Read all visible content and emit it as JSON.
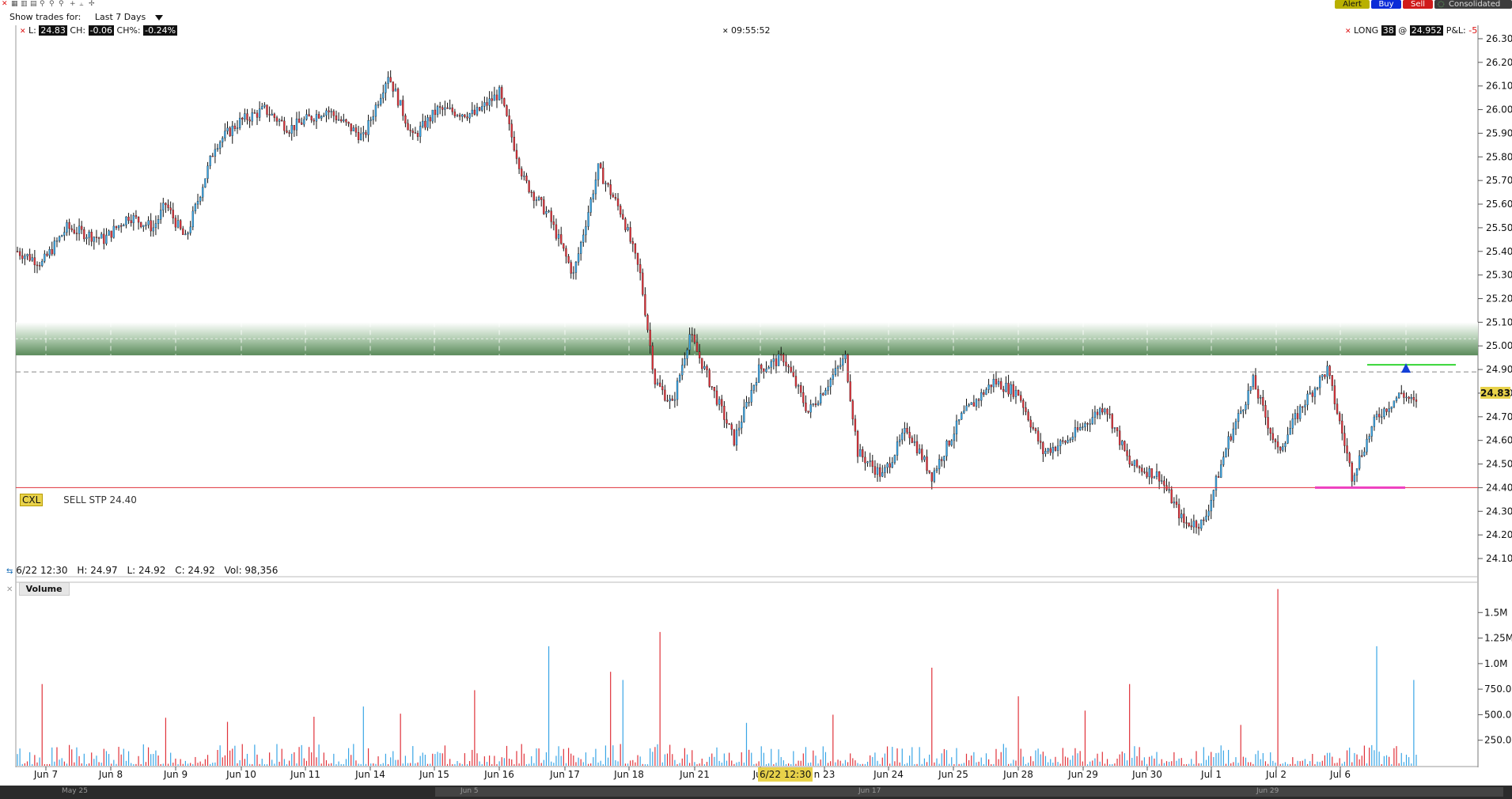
{
  "toolbar": {
    "alert_label": "Alert",
    "buy_label": "Buy",
    "sell_label": "Sell",
    "data_source_label": "Consolidated"
  },
  "filter": {
    "label": "Show trades for:",
    "value": "Last 7 Days"
  },
  "quote": {
    "last_label": "L:",
    "last_value": "24.83",
    "change_label": "CH:",
    "change_value": "-0.06",
    "change_pct_label": "CH%:",
    "change_pct_value": "-0.24%"
  },
  "clock": "09:55:52",
  "position": {
    "side": "LONG",
    "qty": "38",
    "at": "@",
    "price": "24.952",
    "pnl_label": "P&L:",
    "pnl_value": "-5"
  },
  "order": {
    "cancel_label": "CXL",
    "description": "SELL STP 24.40"
  },
  "bar_info": {
    "date": "6/22 12:30",
    "high": "H: 24.97",
    "low": "L: 24.92",
    "close": "C: 24.92",
    "volume": "Vol: 98,356"
  },
  "volume_panel": {
    "title": "Volume"
  },
  "time_axis": {
    "labels": [
      "Jun 7",
      "Jun 8",
      "Jun 9",
      "Jun 10",
      "Jun 11",
      "Jun 14",
      "Jun 15",
      "Jun 16",
      "Jun 17",
      "Jun 18",
      "Jun 21",
      "Jun",
      "n 23",
      "Jun 24",
      "Jun 25",
      "Jun 28",
      "Jun 29",
      "Jun 30",
      "Jul 1",
      "Jul 2",
      "Jul 6"
    ],
    "crosshair_label": "6/22 12:30"
  },
  "overview_labels": [
    "May 25",
    "Jun 5",
    "Jun 17",
    "Jun 29"
  ],
  "colors": {
    "up": "#3aa6e6",
    "down": "#e0323a",
    "support_zone": "#5a8a5a",
    "stop_line": "#e0323a",
    "entry_line": "#34d534",
    "stop_marker": "#ee3fbf"
  },
  "chart_data": {
    "type": "candlestick",
    "price_axis": {
      "ticks": [
        "26.30",
        "26.20",
        "26.10",
        "26.00",
        "25.90",
        "25.80",
        "25.70",
        "25.60",
        "25.50",
        "25.40",
        "25.30",
        "25.20",
        "25.10",
        "25.00",
        "24.90",
        "24.80",
        "24.70",
        "24.60",
        "24.50",
        "24.40",
        "24.30",
        "24.20",
        "24.10"
      ],
      "ylim": [
        24.08,
        26.33
      ],
      "last_price_label": "24.83"
    },
    "levels": {
      "support_zone": [
        24.96,
        25.1
      ],
      "dashed_reference": 24.89,
      "sell_stop": 24.4,
      "entry": 24.92,
      "target_marker": 24.4
    },
    "price_path": [
      [
        0,
        25.4
      ],
      [
        10,
        25.35
      ],
      [
        20,
        25.5
      ],
      [
        35,
        25.45
      ],
      [
        45,
        25.55
      ],
      [
        55,
        25.5
      ],
      [
        60,
        25.6
      ],
      [
        68,
        25.45
      ],
      [
        80,
        25.85
      ],
      [
        90,
        25.95
      ],
      [
        100,
        26.0
      ],
      [
        110,
        25.92
      ],
      [
        125,
        26.0
      ],
      [
        140,
        25.88
      ],
      [
        150,
        26.15
      ],
      [
        160,
        25.88
      ],
      [
        170,
        26.0
      ],
      [
        185,
        25.98
      ],
      [
        195,
        26.07
      ],
      [
        205,
        25.7
      ],
      [
        215,
        25.55
      ],
      [
        225,
        25.3
      ],
      [
        235,
        25.75
      ],
      [
        245,
        25.55
      ],
      [
        252,
        25.3
      ],
      [
        258,
        24.85
      ],
      [
        265,
        24.75
      ],
      [
        272,
        25.05
      ],
      [
        280,
        24.85
      ],
      [
        290,
        24.6
      ],
      [
        300,
        24.9
      ],
      [
        310,
        24.95
      ],
      [
        320,
        24.72
      ],
      [
        335,
        24.95
      ],
      [
        340,
        24.55
      ],
      [
        350,
        24.45
      ],
      [
        360,
        24.65
      ],
      [
        370,
        24.45
      ],
      [
        382,
        24.7
      ],
      [
        395,
        24.85
      ],
      [
        405,
        24.8
      ],
      [
        415,
        24.55
      ],
      [
        425,
        24.6
      ],
      [
        440,
        24.75
      ],
      [
        450,
        24.5
      ],
      [
        462,
        24.45
      ],
      [
        472,
        24.25
      ],
      [
        480,
        24.25
      ],
      [
        490,
        24.6
      ],
      [
        500,
        24.85
      ],
      [
        510,
        24.55
      ],
      [
        520,
        24.75
      ],
      [
        530,
        24.9
      ],
      [
        540,
        24.45
      ],
      [
        550,
        24.7
      ],
      [
        560,
        24.8
      ],
      [
        566,
        24.75
      ]
    ],
    "x_range": [
      0,
      566
    ],
    "volume_axis": {
      "ticks": [
        "1.5M",
        "1.25M",
        "1.0M",
        "750.0K",
        "500.0K",
        "250.0K"
      ],
      "ylim": [
        0,
        1750000
      ]
    },
    "volume_spikes": [
      [
        10,
        800000,
        "down"
      ],
      [
        60,
        470000,
        "down"
      ],
      [
        85,
        430000,
        "down"
      ],
      [
        120,
        480000,
        "down"
      ],
      [
        140,
        580000,
        "up"
      ],
      [
        155,
        510000,
        "down"
      ],
      [
        185,
        740000,
        "down"
      ],
      [
        215,
        1170000,
        "up"
      ],
      [
        240,
        920000,
        "down"
      ],
      [
        245,
        840000,
        "up"
      ],
      [
        260,
        1310000,
        "down"
      ],
      [
        295,
        420000,
        "up"
      ],
      [
        330,
        500000,
        "down"
      ],
      [
        370,
        960000,
        "down"
      ],
      [
        405,
        680000,
        "down"
      ],
      [
        432,
        540000,
        "down"
      ],
      [
        450,
        800000,
        "down"
      ],
      [
        495,
        400000,
        "down"
      ],
      [
        510,
        1730000,
        "down"
      ],
      [
        550,
        1170000,
        "up"
      ],
      [
        565,
        840000,
        "up"
      ]
    ]
  }
}
